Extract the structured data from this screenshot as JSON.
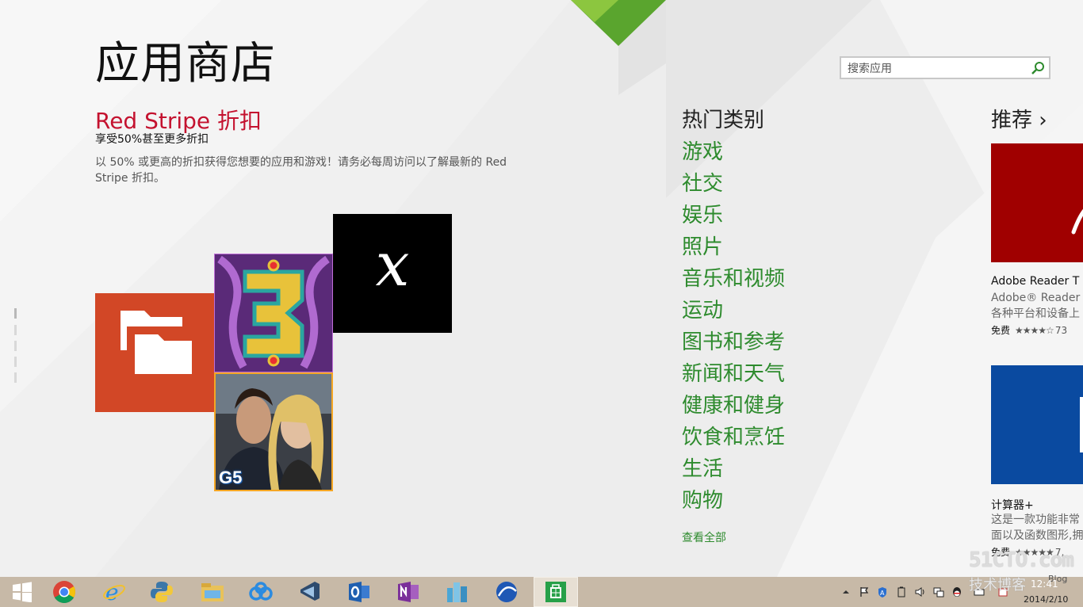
{
  "header": {
    "title": "应用商店"
  },
  "search": {
    "placeholder": "搜索应用"
  },
  "promo": {
    "title": "Red Stripe 折扣",
    "subtitle": "享受50%甚至更多折扣",
    "description": "以 50% 或更高的折扣获得您想要的应用和游戏！请务必每周访问以了解最新的 Red Stripe 折扣。"
  },
  "promo_tiles": [
    {
      "icon": "folder-icon",
      "color": "#d24726"
    },
    {
      "icon": "number-3-puzzle-icon",
      "color": "#5a2a78"
    },
    {
      "icon": "italic-x-icon",
      "label": "x",
      "color": "#000000"
    },
    {
      "icon": "detective-couple-icon",
      "label": "G5",
      "color": "#f5a623"
    }
  ],
  "categories": {
    "heading": "热门类别",
    "items": [
      "游戏",
      "社交",
      "娱乐",
      "照片",
      "音乐和视频",
      "运动",
      "图书和参考",
      "新闻和天气",
      "健康和健身",
      "饮食和烹饪",
      "生活",
      "购物"
    ],
    "see_all": "查看全部",
    "color": "#2e8b2e"
  },
  "recommended": {
    "heading": "推荐 ›",
    "apps": [
      {
        "name": "Adobe Reader T",
        "desc_line1": "Adobe® Reader",
        "desc_line2": "各种平台和设备上",
        "price": "免费",
        "stars": "★★★★☆",
        "count": "73",
        "tile_color": "#a00000"
      },
      {
        "name": "计算器+",
        "desc_line1": "这是一款功能非常",
        "desc_line2": "面以及函数图形,拥",
        "price": "免费",
        "stars": "★★★★★",
        "count": "7,",
        "tile_color": "#0a4aa0"
      }
    ]
  },
  "taskbar": {
    "apps": [
      "start-icon",
      "chrome-icon",
      "internet-explorer-icon",
      "python-icon",
      "file-explorer-icon",
      "cloud-sync-icon",
      "visual-studio-icon",
      "outlook-icon",
      "onenote-icon",
      "city-app-icon",
      "wave-app-icon",
      "store-icon"
    ],
    "active": "store-icon",
    "clock_time": "12:41",
    "clock_date": "2014/2/10"
  },
  "watermark": {
    "text": "51CTO.com",
    "sub": "技术博客",
    "blog": "Blog"
  },
  "colors": {
    "accent_green": "#2e8b2e",
    "promo_red": "#c4122f",
    "taskbar": "#c7b9a7"
  }
}
